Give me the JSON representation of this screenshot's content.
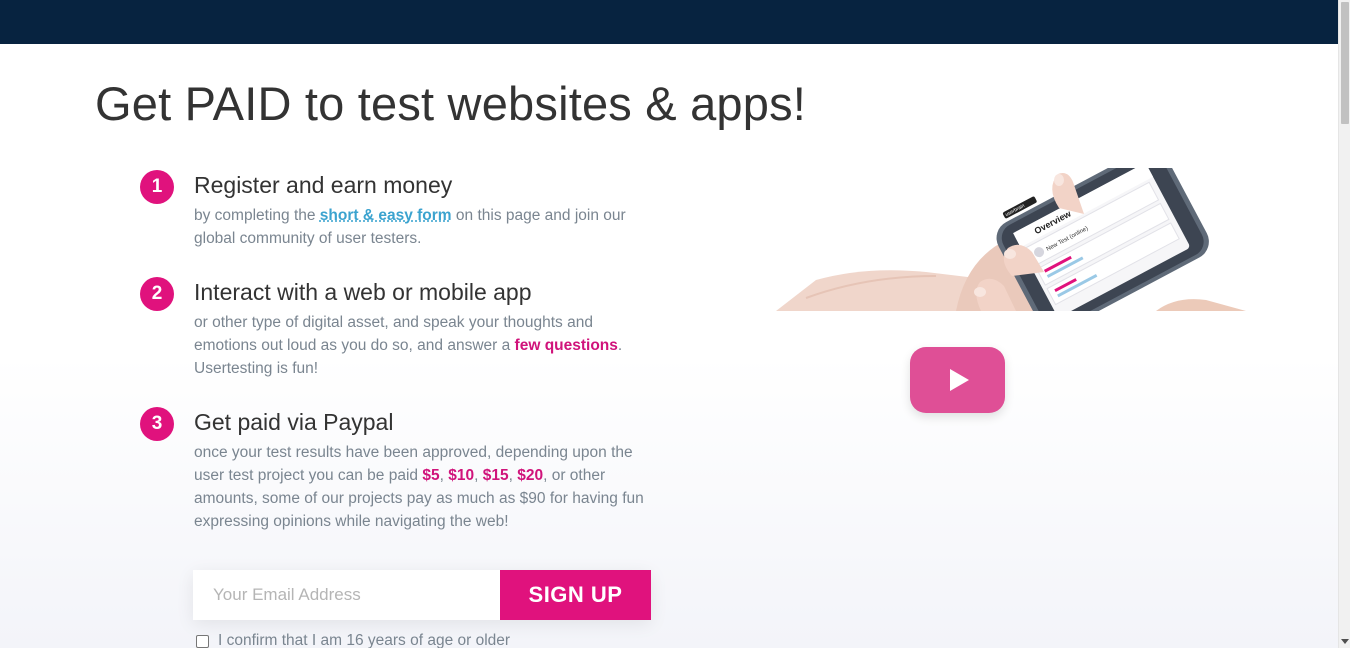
{
  "page": {
    "title": "Get PAID to test websites & apps!"
  },
  "steps": [
    {
      "number": "1",
      "heading": "Register and earn money",
      "desc_parts": [
        "by completing the ",
        "short & easy form",
        " on this page and join our global community of user testers."
      ]
    },
    {
      "number": "2",
      "heading": "Interact with a web or mobile app",
      "desc_parts": [
        "or other type of digital asset, and speak your thoughts and emotions out loud as you do so, and answer a ",
        "few questions",
        ". Usertesting is fun!"
      ]
    },
    {
      "number": "3",
      "heading": "Get paid via Paypal",
      "desc_parts": [
        "once your test results have been approved, depending upon the user test project you can be paid ",
        "$5",
        ", ",
        "$10",
        ", ",
        "$15",
        ", ",
        "$20",
        ", or other amounts, some of our projects pay as much as $90 for having fun expressing opinions while navigating the web!"
      ]
    }
  ],
  "signup": {
    "email_placeholder": "Your Email Address",
    "button_label": "SIGN UP",
    "confirm_label": "I confirm that I am 16 years of age or older"
  },
  "hero": {
    "phone_header": "Overview",
    "phone_brand": "userbrain",
    "phone_item": "New Test (online)"
  },
  "colors": {
    "topbar": "#072340",
    "accent": "#e0127d",
    "link": "#3ba3cf",
    "play": "#df4f96"
  },
  "icons": {
    "play": "play-icon",
    "checkbox": "checkbox-icon"
  }
}
